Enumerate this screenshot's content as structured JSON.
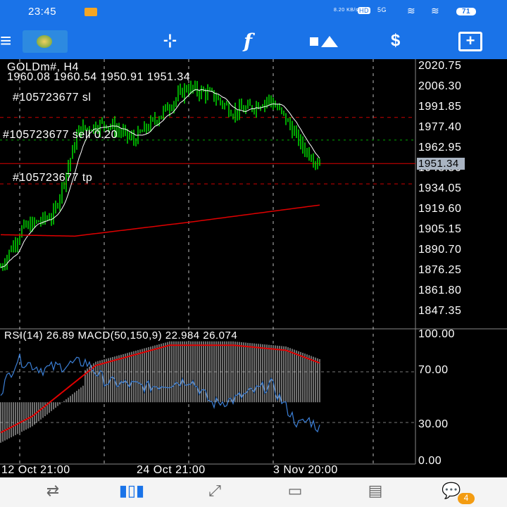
{
  "status": {
    "time": "23:45",
    "net_speed": "8.20 KB/s",
    "hd": "HD",
    "signal": "5G",
    "battery": "71"
  },
  "toolbar": {
    "menu": "≡",
    "crosshair": "-¦-",
    "indicators": "f",
    "objects": "objects",
    "trade": "$",
    "new_order": "+"
  },
  "chart": {
    "symbol": "GOLDm#, H4",
    "ohlc": "1960.08 1960.54 1950.91 1951.34",
    "order_sl": "#105723677 sl",
    "order_sell": "#105723677 sell 0.20",
    "order_tp": "#105723677 tp",
    "current_price": "1951.34",
    "price_labels": [
      "2020.75",
      "2006.30",
      "1991.85",
      "1977.40",
      "1962.95",
      "1948.50",
      "1934.05",
      "1919.60",
      "1905.15",
      "1890.70",
      "1876.25",
      "1861.80",
      "1847.35"
    ],
    "time_labels": [
      "12 Oct 21:00",
      "24 Oct 21:00",
      "3 Nov 20:00"
    ],
    "sub_title": "RSI(14) 26.89 MACD(50,150,9) 22.984 26.074",
    "sub_levels": [
      "100.00",
      "70.00",
      "30.00",
      "0.00"
    ]
  },
  "chart_data": {
    "type": "line",
    "title": "GOLDm#, H4",
    "ylim": [
      1847.35,
      2020.75
    ],
    "levels": {
      "sl": 1984,
      "sell": 1968,
      "tp": 1937,
      "current": 1951.34
    },
    "close_keypoints": [
      [
        0,
        1878
      ],
      [
        10,
        1905
      ],
      [
        25,
        1915
      ],
      [
        37,
        1975
      ],
      [
        50,
        1980
      ],
      [
        63,
        1968
      ],
      [
        75,
        1985
      ],
      [
        88,
        2005
      ],
      [
        100,
        2000
      ],
      [
        110,
        1988
      ],
      [
        117,
        1990
      ],
      [
        127,
        1997
      ],
      [
        134,
        1985
      ],
      [
        143,
        1963
      ],
      [
        151,
        1951
      ]
    ],
    "ma200_keypoints": [
      [
        0,
        1901
      ],
      [
        35,
        1900
      ],
      [
        90,
        1910
      ],
      [
        151,
        1922
      ]
    ],
    "rsi_keypoints": [
      [
        0,
        55
      ],
      [
        8,
        80
      ],
      [
        20,
        72
      ],
      [
        40,
        78
      ],
      [
        50,
        62
      ],
      [
        70,
        58
      ],
      [
        90,
        64
      ],
      [
        100,
        45
      ],
      [
        110,
        48
      ],
      [
        128,
        60
      ],
      [
        135,
        42
      ],
      [
        141,
        28
      ],
      [
        146,
        32
      ],
      [
        151,
        25
      ]
    ],
    "macd_signal_keypoints": [
      [
        0,
        22
      ],
      [
        15,
        35
      ],
      [
        45,
        75
      ],
      [
        80,
        91
      ],
      [
        110,
        91
      ],
      [
        135,
        87
      ],
      [
        151,
        77
      ]
    ]
  },
  "nav": {
    "items": [
      "quotes",
      "chart",
      "trade",
      "history",
      "news",
      "messages"
    ],
    "messages_badge": "4"
  },
  "colors": {
    "accent": "#1a73e8",
    "bull": "#00ff00",
    "ma": "#e00000",
    "rsi": "#3b7fd6",
    "badge": "#f39c12"
  }
}
